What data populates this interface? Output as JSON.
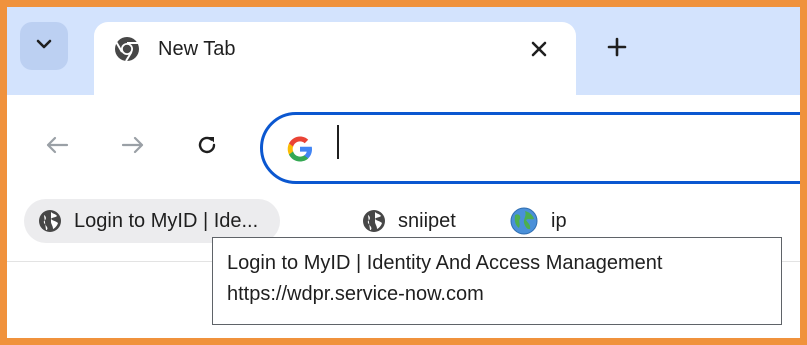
{
  "tabs": [
    {
      "title": "New Tab",
      "favicon": "chrome-icon",
      "active": true
    }
  ],
  "toolbar": {
    "back_icon": "arrow-left-icon",
    "forward_icon": "arrow-right-icon",
    "reload_icon": "reload-icon"
  },
  "omnibox": {
    "value": "",
    "search_engine_icon": "google-g-icon"
  },
  "bookmarks": [
    {
      "label": "Login to MyID | Ide...",
      "icon": "globe-icon",
      "hovered": true
    },
    {
      "label": "sniipet",
      "icon": "globe-icon",
      "hovered": false
    },
    {
      "label": "ip",
      "icon": "earth-icon",
      "hovered": false
    }
  ],
  "tooltip": {
    "title": "Login to MyID | Identity And Access Management",
    "url": "https://wdpr.service-now.com"
  },
  "colors": {
    "border_highlight": "#f0923c",
    "tabstrip_bg": "#d3e3fd",
    "omnibox_focus": "#0b57d0",
    "icon_dark": "#474747"
  }
}
